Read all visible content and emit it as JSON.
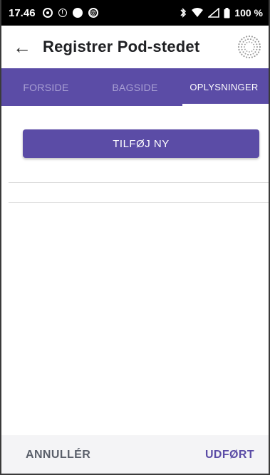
{
  "status_bar": {
    "time": "17.46",
    "battery": "100 %",
    "icons_left": [
      "location-dot-icon",
      "info-icon",
      "circle-icon",
      "at-icon"
    ],
    "icons_right": [
      "bluetooth-icon",
      "wifi-icon",
      "signal-icon",
      "battery-icon"
    ]
  },
  "app_bar": {
    "back_icon": "←",
    "title": "Registrer Pod-stedet"
  },
  "tabs": [
    {
      "label": "FORSIDE",
      "active": false
    },
    {
      "label": "BAGSIDE",
      "active": false
    },
    {
      "label": "OPLYSNINGER",
      "active": true
    }
  ],
  "content": {
    "add_button_label": "TILFØJ NY"
  },
  "bottom_bar": {
    "cancel_label": "ANNULLÉR",
    "done_label": "UDFØRT"
  },
  "colors": {
    "primary": "#5b4ca6",
    "tab_inactive_text": "#a9a0d4",
    "bottom_bar_bg": "#f4f4f6"
  }
}
